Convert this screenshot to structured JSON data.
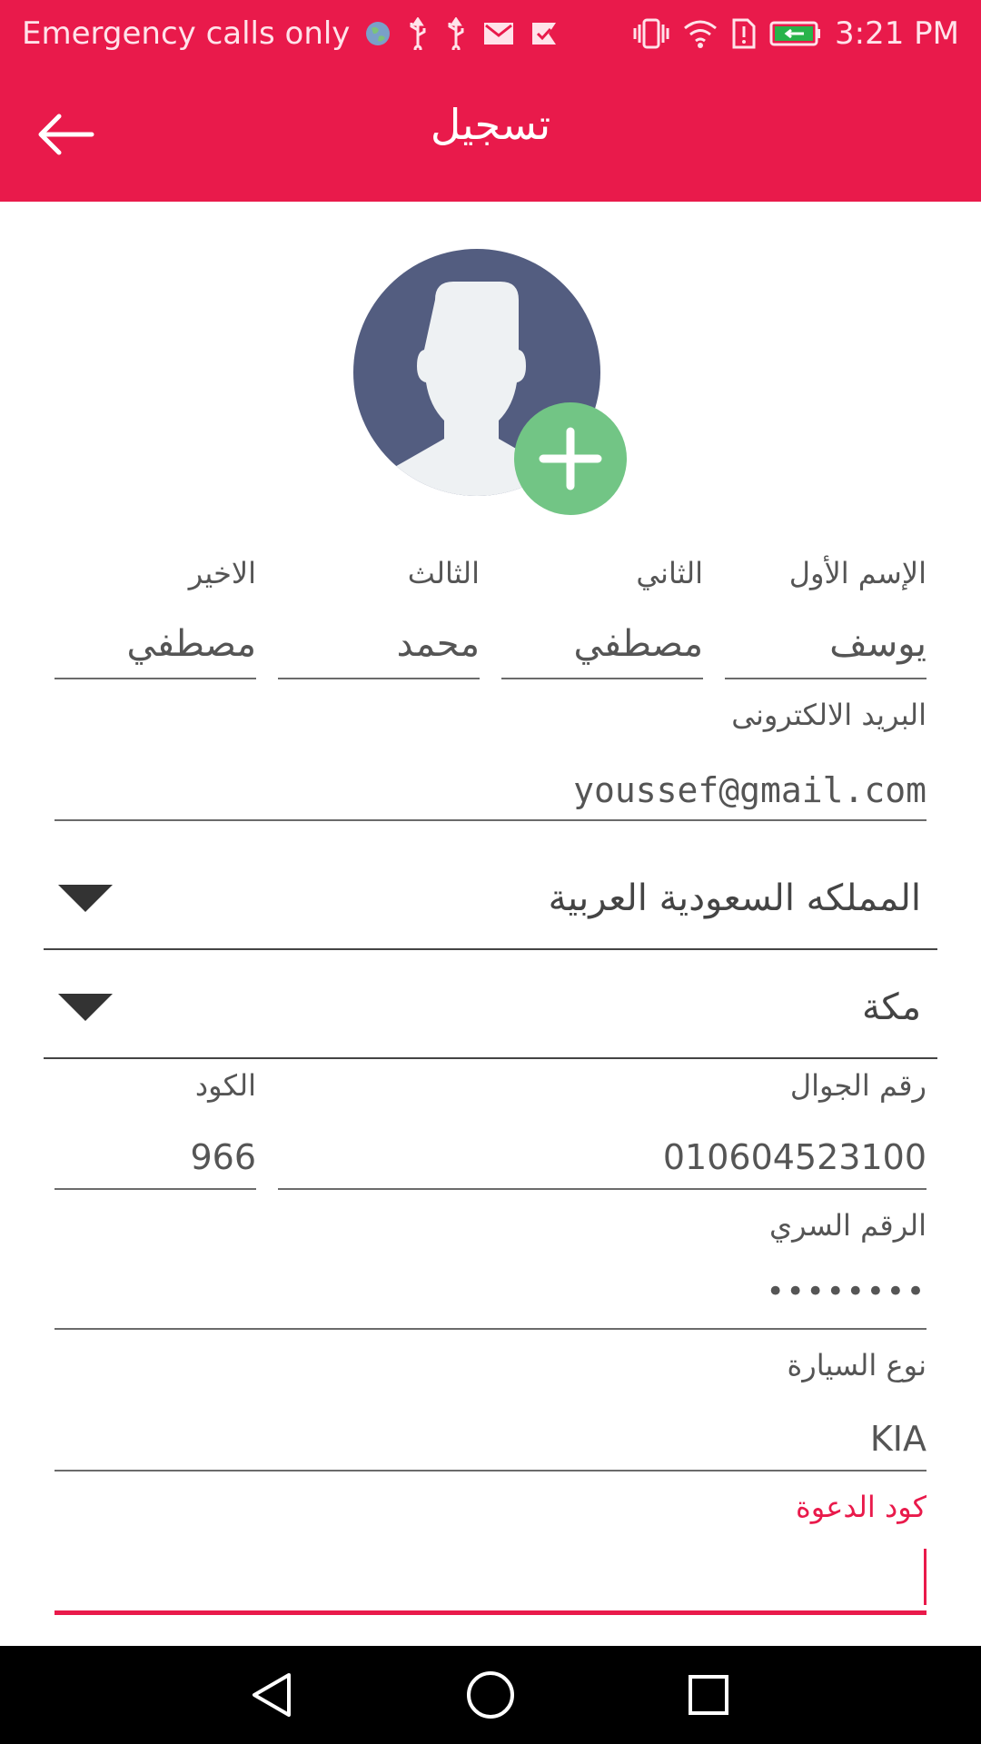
{
  "status_bar": {
    "carrier_text": "Emergency calls only",
    "time": "3:21 PM",
    "icons_left": [
      "globe-icon",
      "usb-icon",
      "usb-icon",
      "gmail-icon",
      "check-icon"
    ],
    "icons_right": [
      "vibrate-icon",
      "wifi-icon",
      "sim-alert-icon",
      "battery-charging-icon"
    ]
  },
  "toolbar": {
    "title": "تسجيل",
    "back_icon": "arrow-left-icon"
  },
  "avatar": {
    "icon": "person-icon",
    "add_icon": "plus-icon"
  },
  "name_fields": [
    {
      "label": "الإسم الأول",
      "value": "يوسف"
    },
    {
      "label": "الثاني",
      "value": "مصطفي"
    },
    {
      "label": "الثالث",
      "value": "محمد"
    },
    {
      "label": "الاخير",
      "value": "مصطفي"
    }
  ],
  "email": {
    "label": "البريد الالكترونى",
    "value": "youssef@gmail.com"
  },
  "country_select": {
    "value": "المملكه السعودية العربية"
  },
  "city_select": {
    "value": "مكة"
  },
  "phone": {
    "label": "رقم الجوال",
    "value": "010604523100"
  },
  "country_code": {
    "label": "الكود",
    "value": "966"
  },
  "password": {
    "label": "الرقم السري",
    "value": "••••••••"
  },
  "car_type": {
    "label": "نوع السيارة",
    "value": "KIA"
  },
  "invite_code": {
    "label": "كود الدعوة",
    "value": ""
  },
  "colors": {
    "primary": "#e91a4b",
    "add_button": "#72c585",
    "avatar_bg": "#535d80"
  },
  "nav_bar": {
    "icons": [
      "back-triangle-icon",
      "home-circle-icon",
      "recents-square-icon"
    ]
  }
}
